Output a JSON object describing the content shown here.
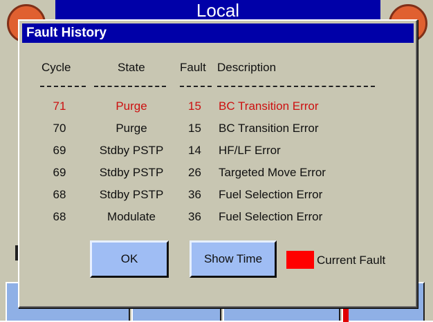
{
  "background": {
    "title": "Local"
  },
  "dialog": {
    "title": "Fault History",
    "columns": [
      "Cycle",
      "State",
      "Fault",
      "Description"
    ],
    "rows": [
      {
        "cycle": "71",
        "state": "Purge",
        "fault": "15",
        "description": "BC Transition Error",
        "current": true
      },
      {
        "cycle": "70",
        "state": "Purge",
        "fault": "15",
        "description": "BC Transition Error",
        "current": false
      },
      {
        "cycle": "69",
        "state": "Stdby PSTP",
        "fault": "14",
        "description": "HF/LF Error",
        "current": false
      },
      {
        "cycle": "69",
        "state": "Stdby PSTP",
        "fault": "26",
        "description": "Targeted Move Error",
        "current": false
      },
      {
        "cycle": "68",
        "state": "Stdby PSTP",
        "fault": "36",
        "description": "Fuel Selection Error",
        "current": false
      },
      {
        "cycle": "68",
        "state": "Modulate",
        "fault": "36",
        "description": "Fuel Selection Error",
        "current": false
      }
    ],
    "ok_label": "OK",
    "show_time_label": "Show Time",
    "legend_label": "Current Fault"
  },
  "colors": {
    "current_fault": "#ff0000",
    "current_text": "#cc1010",
    "titlebar": "#0000a8",
    "button": "#9fbdf4",
    "panel": "#c8c6b2"
  }
}
